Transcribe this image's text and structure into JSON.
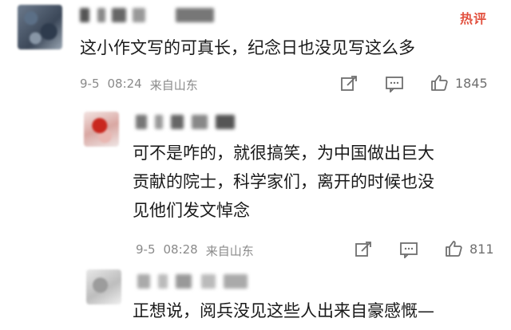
{
  "comments": [
    {
      "text": "这小作文写的可真长，纪念日也没见写这么多",
      "date": "9-5",
      "time": "08:24",
      "location": "来自山东",
      "likes": "1845",
      "hot_tag": "热评"
    },
    {
      "text_lines": [
        "可不是咋的，就很搞笑，为中国做出巨大",
        "贡献的院士，科学家们，离开的时候也没",
        "见他们发文悼念"
      ],
      "date": "9-5",
      "time": "08:28",
      "location": "来自山东",
      "likes": "811"
    },
    {
      "text": "正想说，阅兵没见这些人出来自豪感慨—"
    }
  ],
  "icons": [
    "share-icon",
    "comment-icon",
    "like-icon"
  ],
  "colors": {
    "hot_tag": "#e2513f",
    "meta_text": "#8a8a8a",
    "icon": "#6f6f6f"
  }
}
